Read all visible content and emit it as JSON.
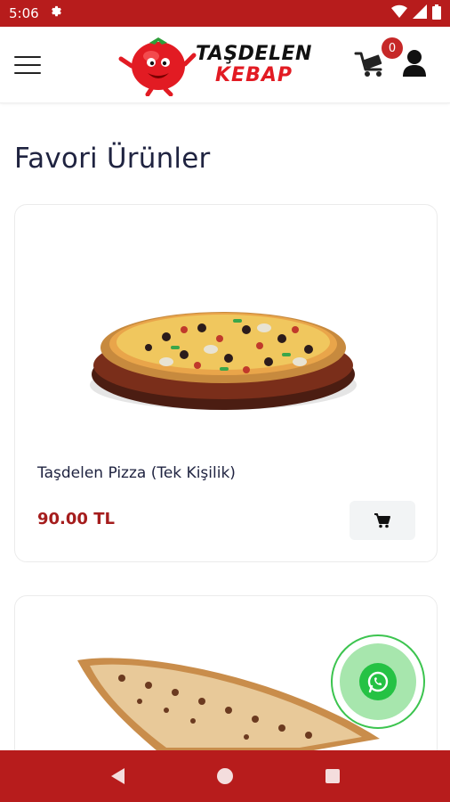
{
  "status_bar": {
    "time": "5:06"
  },
  "header": {
    "logo_line1": "TAŞDELEN",
    "logo_line2": "KEBAP",
    "cart_count": "0"
  },
  "page": {
    "title": "Favori Ürünler"
  },
  "products": [
    {
      "name": "Taşdelen Pizza (Tek Kişilik)",
      "price": "90.00 TL"
    }
  ],
  "colors": {
    "brand_red": "#b71c1c",
    "price_red": "#a51d1d",
    "whatsapp_green": "#25c244"
  }
}
